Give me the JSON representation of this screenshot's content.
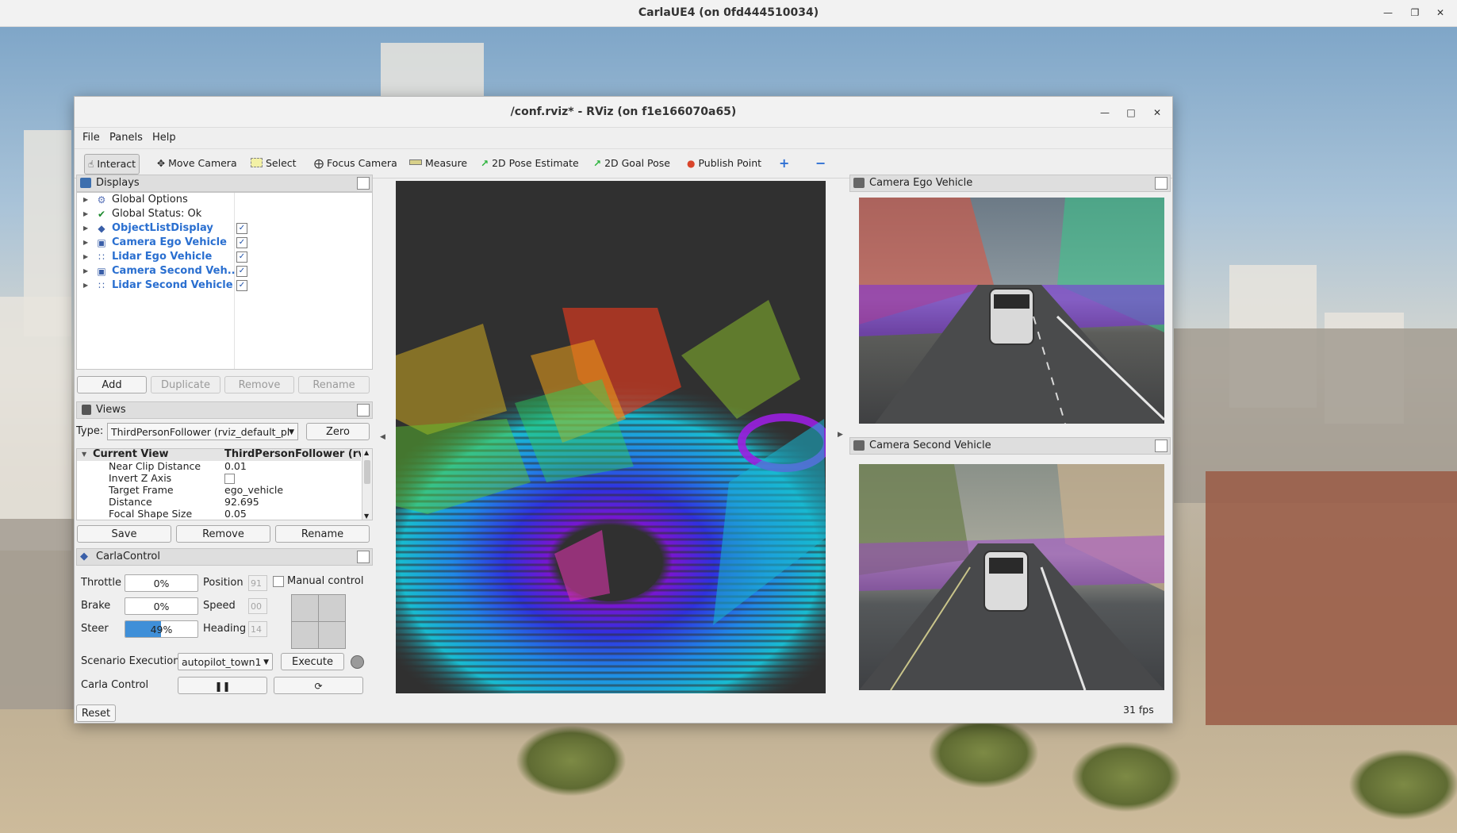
{
  "outer_window": {
    "title": "CarlaUE4   (on 0fd444510034)"
  },
  "rviz": {
    "title": "/conf.rviz* - RViz (on f1e166070a65)",
    "menu": {
      "file": "File",
      "panels": "Panels",
      "help": "Help"
    },
    "toolbar": {
      "interact": "Interact",
      "move_camera": "Move Camera",
      "select": "Select",
      "focus_camera": "Focus Camera",
      "measure": "Measure",
      "pose_estimate": "2D Pose Estimate",
      "goal_pose": "2D Goal Pose",
      "publish_point": "Publish Point"
    },
    "displays": {
      "title": "Displays",
      "items": [
        {
          "label": "Global Options",
          "icon": "gear-icon"
        },
        {
          "label": "Global Status: Ok",
          "icon": "check-icon"
        },
        {
          "label": "ObjectListDisplay",
          "icon": "diamond-icon",
          "checked": true
        },
        {
          "label": "Camera Ego Vehicle",
          "icon": "camera-icon",
          "checked": true
        },
        {
          "label": "Lidar Ego Vehicle",
          "icon": "pointcloud-icon",
          "checked": true
        },
        {
          "label": "Camera Second Veh...",
          "icon": "camera-icon",
          "checked": true
        },
        {
          "label": "Lidar Second Vehicle",
          "icon": "pointcloud-icon",
          "checked": true
        }
      ],
      "buttons": {
        "add": "Add",
        "duplicate": "Duplicate",
        "remove": "Remove",
        "rename": "Rename"
      }
    },
    "views": {
      "title": "Views",
      "type_label": "Type:",
      "type_value": "ThirdPersonFollower (rviz_default_pl",
      "zero": "Zero",
      "current_view": "Current View",
      "current_view_value": "ThirdPersonFollower (rvi...",
      "props": [
        {
          "name": "Near Clip Distance",
          "value": "0.01"
        },
        {
          "name": "Invert Z Axis",
          "value": ""
        },
        {
          "name": "Target Frame",
          "value": "ego_vehicle"
        },
        {
          "name": "Distance",
          "value": "92.695"
        },
        {
          "name": "Focal Shape Size",
          "value": "0.05"
        }
      ],
      "buttons": {
        "save": "Save",
        "remove": "Remove",
        "rename": "Rename"
      }
    },
    "carla_control": {
      "title": "CarlaControl",
      "throttle_label": "Throttle",
      "throttle": "0%",
      "brake_label": "Brake",
      "brake": "0%",
      "steer_label": "Steer",
      "steer": "49%",
      "steer_fraction": 0.49,
      "position_label": "Position",
      "position": "91",
      "speed_label": "Speed",
      "speed": "00",
      "heading_label": "Heading",
      "heading": "14",
      "manual_control": "Manual control",
      "scenario_label": "Scenario Execution",
      "scenario_value": "autopilot_town1",
      "execute": "Execute",
      "carla_control_label": "Carla Control",
      "pause_icon": "pause-icon",
      "step_icon": "step-icon"
    },
    "reset": "Reset",
    "fps": "31 fps",
    "camera_ego": {
      "title": "Camera Ego Vehicle"
    },
    "camera_second": {
      "title": "Camera Second Vehicle"
    }
  }
}
